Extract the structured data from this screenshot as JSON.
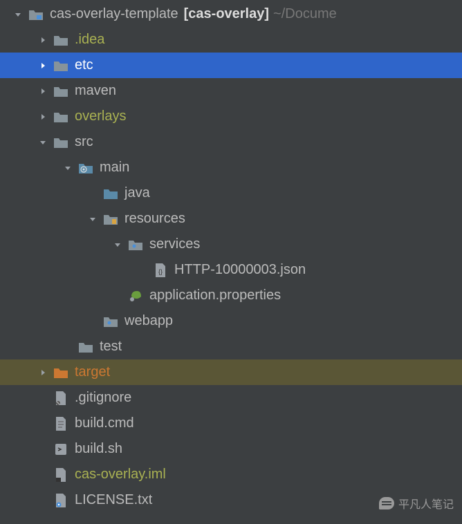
{
  "root": {
    "name": "cas-overlay-template",
    "context": "[cas-overlay]",
    "path_suffix": "~/Docume"
  },
  "items": [
    {
      "id": "root",
      "indent": 0,
      "arrow": "down",
      "icon": "folder-module",
      "label": "cas-overlay-template",
      "colorClass": "",
      "selected": false
    },
    {
      "id": "idea",
      "indent": 1,
      "arrow": "right",
      "icon": "folder",
      "label": ".idea",
      "colorClass": "olive",
      "selected": false
    },
    {
      "id": "etc",
      "indent": 1,
      "arrow": "right",
      "icon": "folder",
      "label": "etc",
      "colorClass": "",
      "selected": true
    },
    {
      "id": "maven",
      "indent": 1,
      "arrow": "right",
      "icon": "folder",
      "label": "maven",
      "colorClass": "",
      "selected": false
    },
    {
      "id": "overlays",
      "indent": 1,
      "arrow": "right",
      "icon": "folder",
      "label": "overlays",
      "colorClass": "olive",
      "selected": false
    },
    {
      "id": "src",
      "indent": 1,
      "arrow": "down",
      "icon": "folder",
      "label": "src",
      "colorClass": "",
      "selected": false
    },
    {
      "id": "main",
      "indent": 2,
      "arrow": "down",
      "icon": "folder-gear",
      "label": "main",
      "colorClass": "",
      "selected": false
    },
    {
      "id": "java",
      "indent": 3,
      "arrow": "none",
      "icon": "folder-source",
      "label": "java",
      "colorClass": "",
      "selected": false
    },
    {
      "id": "resources",
      "indent": 3,
      "arrow": "down",
      "icon": "folder-resources",
      "label": "resources",
      "colorClass": "",
      "selected": false
    },
    {
      "id": "services",
      "indent": 4,
      "arrow": "down",
      "icon": "folder-dot",
      "label": "services",
      "colorClass": "",
      "selected": false
    },
    {
      "id": "http-json",
      "indent": 5,
      "arrow": "none",
      "icon": "file-json",
      "label": "HTTP-10000003.json",
      "colorClass": "",
      "selected": false
    },
    {
      "id": "app-props",
      "indent": 4,
      "arrow": "none",
      "icon": "file-leaf",
      "label": "application.properties",
      "colorClass": "",
      "selected": false
    },
    {
      "id": "webapp",
      "indent": 3,
      "arrow": "none",
      "icon": "folder-dot",
      "label": "webapp",
      "colorClass": "",
      "selected": false
    },
    {
      "id": "test",
      "indent": 2,
      "arrow": "none",
      "icon": "folder",
      "label": "test",
      "colorClass": "",
      "selected": false
    },
    {
      "id": "target",
      "indent": 1,
      "arrow": "right",
      "icon": "folder-orange",
      "label": "target",
      "colorClass": "orange",
      "selected": false,
      "highlighted": true
    },
    {
      "id": "gitignore",
      "indent": 1,
      "arrow": "none",
      "icon": "file-git",
      "label": ".gitignore",
      "colorClass": "",
      "selected": false
    },
    {
      "id": "build-cmd",
      "indent": 1,
      "arrow": "none",
      "icon": "file-text",
      "label": "build.cmd",
      "colorClass": "",
      "selected": false
    },
    {
      "id": "build-sh",
      "indent": 1,
      "arrow": "none",
      "icon": "file-sh",
      "label": "build.sh",
      "colorClass": "",
      "selected": false
    },
    {
      "id": "cas-iml",
      "indent": 1,
      "arrow": "none",
      "icon": "file-iml",
      "label": "cas-overlay.iml",
      "colorClass": "olive",
      "selected": false
    },
    {
      "id": "license",
      "indent": 1,
      "arrow": "none",
      "icon": "file-gear",
      "label": "LICENSE.txt",
      "colorClass": "",
      "selected": false
    }
  ],
  "watermark": "平凡人笔记"
}
